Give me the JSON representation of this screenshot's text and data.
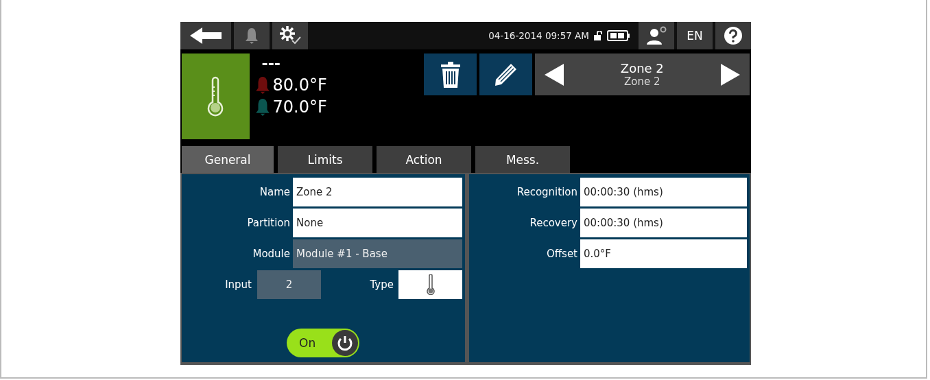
{
  "top_bar": {
    "datetime": "04-16-2014 09:57 AM",
    "language": "EN"
  },
  "zone": {
    "status": "---",
    "high_limit": "80.0°F",
    "low_limit": "70.0°F",
    "title": "Zone 2",
    "subtitle": "Zone 2"
  },
  "tabs": [
    {
      "label": "General",
      "selected": true
    },
    {
      "label": "Limits",
      "selected": false
    },
    {
      "label": "Action",
      "selected": false
    },
    {
      "label": "Mess.",
      "selected": false
    }
  ],
  "left_fields": [
    {
      "label": "Name",
      "value": "Zone 2",
      "disabled": false
    },
    {
      "label": "Partition",
      "value": "None",
      "disabled": false
    },
    {
      "label": "Module",
      "value": "Module #1 - Base",
      "disabled": true
    }
  ],
  "input": {
    "label": "Input",
    "value": "2"
  },
  "type": {
    "label": "Type"
  },
  "switch": {
    "label": "On",
    "on": true
  },
  "right_fields": [
    {
      "label": "Recognition",
      "value": "00:00:30 (hms)",
      "disabled": false
    },
    {
      "label": "Recovery",
      "value": "00:00:30 (hms)",
      "disabled": false
    },
    {
      "label": "Offset",
      "value": "0.0°F",
      "disabled": false
    }
  ]
}
